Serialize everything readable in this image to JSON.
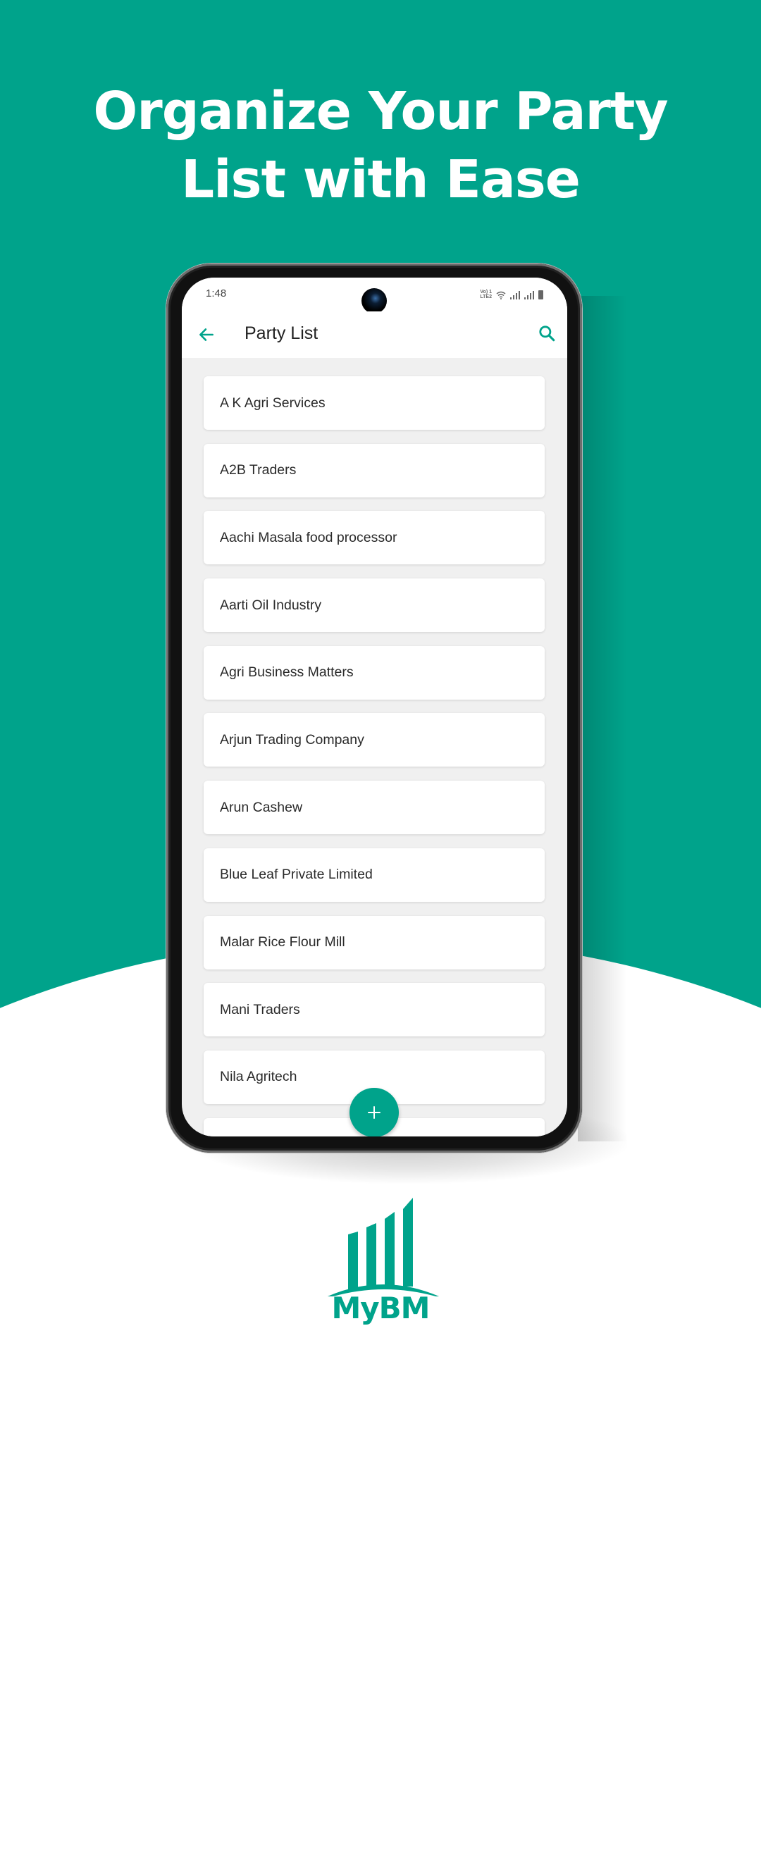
{
  "colors": {
    "brand_teal": "#00a38b",
    "background_white": "#ffffff",
    "list_background": "#f0f0f0",
    "text_dark": "#222222"
  },
  "headline": {
    "line1": "Organize Your Party",
    "line2": "List with Ease"
  },
  "phone": {
    "status_bar": {
      "time": "1:48",
      "network_label_top": "Vo) 1",
      "network_label_bottom": "LTE2",
      "icons": [
        "volte-icon",
        "wifi-icon",
        "signal-icon-sim1",
        "signal-icon-sim2",
        "battery-icon"
      ]
    },
    "app_bar": {
      "back_icon": "arrow-left-icon",
      "title": "Party List",
      "search_icon": "search-icon"
    },
    "party_list": [
      "A K Agri Services",
      "A2B Traders",
      "Aachi Masala food processor",
      "Aarti Oil Industry",
      "Agri Business Matters",
      "Arjun Trading Company",
      "Arun Cashew",
      "Blue Leaf Private Limited",
      "Malar Rice Flour Mill",
      "Mani Traders",
      "Nila Agritech",
      ""
    ],
    "fab": {
      "icon": "plus-icon",
      "symbol": "+"
    }
  },
  "logo": {
    "text": "MyBM",
    "icon": "bar-chart-growth-icon"
  }
}
